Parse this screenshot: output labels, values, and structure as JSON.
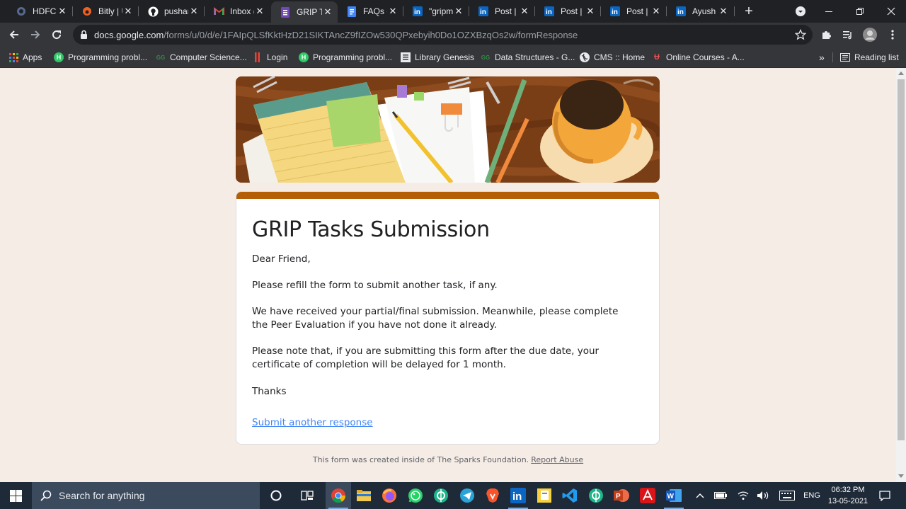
{
  "browser": {
    "tabs": [
      {
        "title": "HDFC B",
        "icon": "hdfc-favicon",
        "active": false
      },
      {
        "title": "Bitly | U",
        "icon": "bitly-favicon",
        "active": false
      },
      {
        "title": "pushar",
        "icon": "github-favicon",
        "active": false
      },
      {
        "title": "Inbox (",
        "icon": "gmail-favicon",
        "active": false
      },
      {
        "title": "GRIP Ta",
        "icon": "google-forms-favicon",
        "active": true
      },
      {
        "title": "FAQs o",
        "icon": "google-docs-favicon",
        "active": false
      },
      {
        "title": "\"gripm",
        "icon": "linkedin-favicon",
        "active": false
      },
      {
        "title": "Post | L",
        "icon": "linkedin-favicon",
        "active": false
      },
      {
        "title": "Post | L",
        "icon": "linkedin-favicon",
        "active": false
      },
      {
        "title": "Post | L",
        "icon": "linkedin-favicon",
        "active": false
      },
      {
        "title": "Ayush",
        "icon": "linkedin-favicon",
        "active": false
      }
    ],
    "url_host": "docs.google.com",
    "url_path": "/forms/u/0/d/e/1FAIpQLSfKktHzD21SIKTAncZ9fIZOw530QPxebyih0Do1OZXBzqOs2w/formResponse",
    "bookmarks": [
      {
        "label": "Apps",
        "icon": "apps-grid-icon"
      },
      {
        "label": "Programming probl...",
        "icon": "hackerrank-icon"
      },
      {
        "label": "Computer Science...",
        "icon": "geeksforgeeks-icon"
      },
      {
        "label": "Login",
        "icon": "login-bookmark-icon"
      },
      {
        "label": "Programming probl...",
        "icon": "hackerrank-icon"
      },
      {
        "label": "Library Genesis",
        "icon": "libgen-icon"
      },
      {
        "label": "Data Structures - G...",
        "icon": "geeksforgeeks-icon"
      },
      {
        "label": "CMS :: Home",
        "icon": "globe-icon"
      },
      {
        "label": "Online Courses - A...",
        "icon": "udemy-icon"
      }
    ],
    "reading_list": "Reading list",
    "overflow": "»"
  },
  "form": {
    "title": "GRIP Tasks Submission",
    "greeting": "Dear Friend,",
    "para1": "Please refill the form to submit another task, if any.",
    "para2": "We have received your partial/final submission. Meanwhile, please complete the Peer Evaluation if you have not done it already.",
    "para3": "Please note that, if you are submitting this form after the due date, your certificate of completion will be delayed for 1 month.",
    "thanks": "Thanks",
    "submit_another": "Submit another response",
    "footer_text": "This form was created inside of The Sparks Foundation.",
    "report_abuse": "Report Abuse",
    "accent_color": "#b45f06"
  },
  "taskbar": {
    "search_placeholder": "Search for anything",
    "language": "ENG",
    "time": "06:32 PM",
    "date": "13-05-2021"
  }
}
